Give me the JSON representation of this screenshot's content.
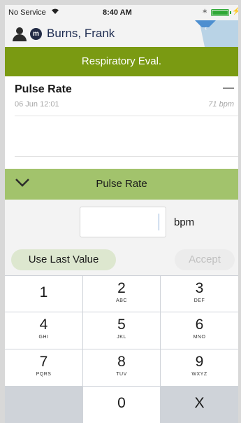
{
  "status_bar": {
    "carrier": "No Service",
    "wifi_icon": "wifi-icon",
    "time": "8:40 AM",
    "bluetooth_icon": "bluetooth-icon",
    "battery_icon": "battery-icon",
    "battery_color": "#2ea836"
  },
  "patient": {
    "avatar_icon": "person-icon",
    "badge": "m",
    "name": "Burns, Frank"
  },
  "title_bar": {
    "title": "Respiratory Eval.",
    "color": "#7a9a12"
  },
  "list_item": {
    "title": "Pulse Rate",
    "date": "06 Jun 12:01",
    "dash": "—",
    "last_value": "71 bpm"
  },
  "section": {
    "title": "Pulse Rate",
    "icon": "chevron-down-icon",
    "color": "#a2c36c"
  },
  "input": {
    "value": "",
    "unit": "bpm"
  },
  "buttons": {
    "use_last": "Use Last Value",
    "accept": "Accept"
  },
  "keypad": {
    "keys": [
      {
        "num": "1",
        "letters": ""
      },
      {
        "num": "2",
        "letters": "ABC"
      },
      {
        "num": "3",
        "letters": "DEF"
      },
      {
        "num": "4",
        "letters": "GHI"
      },
      {
        "num": "5",
        "letters": "JKL"
      },
      {
        "num": "6",
        "letters": "MNO"
      },
      {
        "num": "7",
        "letters": "PQRS"
      },
      {
        "num": "8",
        "letters": "TUV"
      },
      {
        "num": "9",
        "letters": "WXYZ"
      },
      {
        "num": "0",
        "letters": ""
      },
      {
        "num": "X",
        "letters": ""
      }
    ]
  }
}
